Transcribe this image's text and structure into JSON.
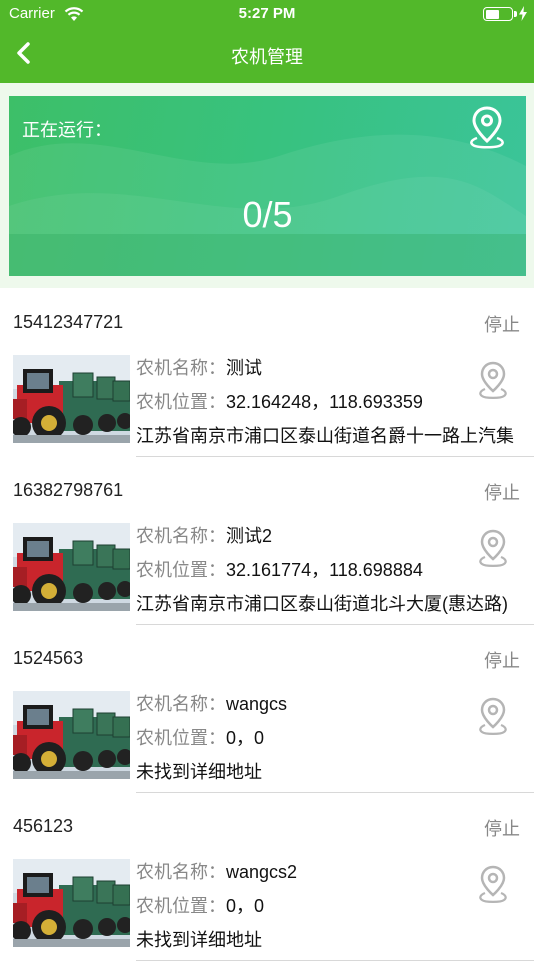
{
  "status_bar": {
    "carrier": "Carrier",
    "time": "5:27 PM"
  },
  "nav": {
    "title": "农机管理",
    "back_icon": "chevron-left-icon"
  },
  "banner": {
    "label": "正在运行：",
    "count": "0/5",
    "icon": "location-pin-icon"
  },
  "labels": {
    "name": "农机名称：",
    "position": "农机位置："
  },
  "machines": [
    {
      "id": "15412347721",
      "status": "停止",
      "name": "测试",
      "position": "32.164248，118.693359",
      "address": "江苏省南京市浦口区泰山街道名爵十一路上汽集"
    },
    {
      "id": "16382798761",
      "status": "停止",
      "name": "测试2",
      "position": "32.161774，118.698884",
      "address": "江苏省南京市浦口区泰山街道北斗大厦(惠达路)"
    },
    {
      "id": "1524563",
      "status": "停止",
      "name": "wangcs",
      "position": "0，0",
      "address": "未找到详细地址"
    },
    {
      "id": "456123",
      "status": "停止",
      "name": "wangcs2",
      "position": "0，0",
      "address": "未找到详细地址"
    }
  ],
  "colors": {
    "header": "#52b82a",
    "banner_start": "#3dbf68",
    "banner_end": "#3bc49a",
    "muted_text": "#888888",
    "pin_gray": "#b5b5b5"
  }
}
